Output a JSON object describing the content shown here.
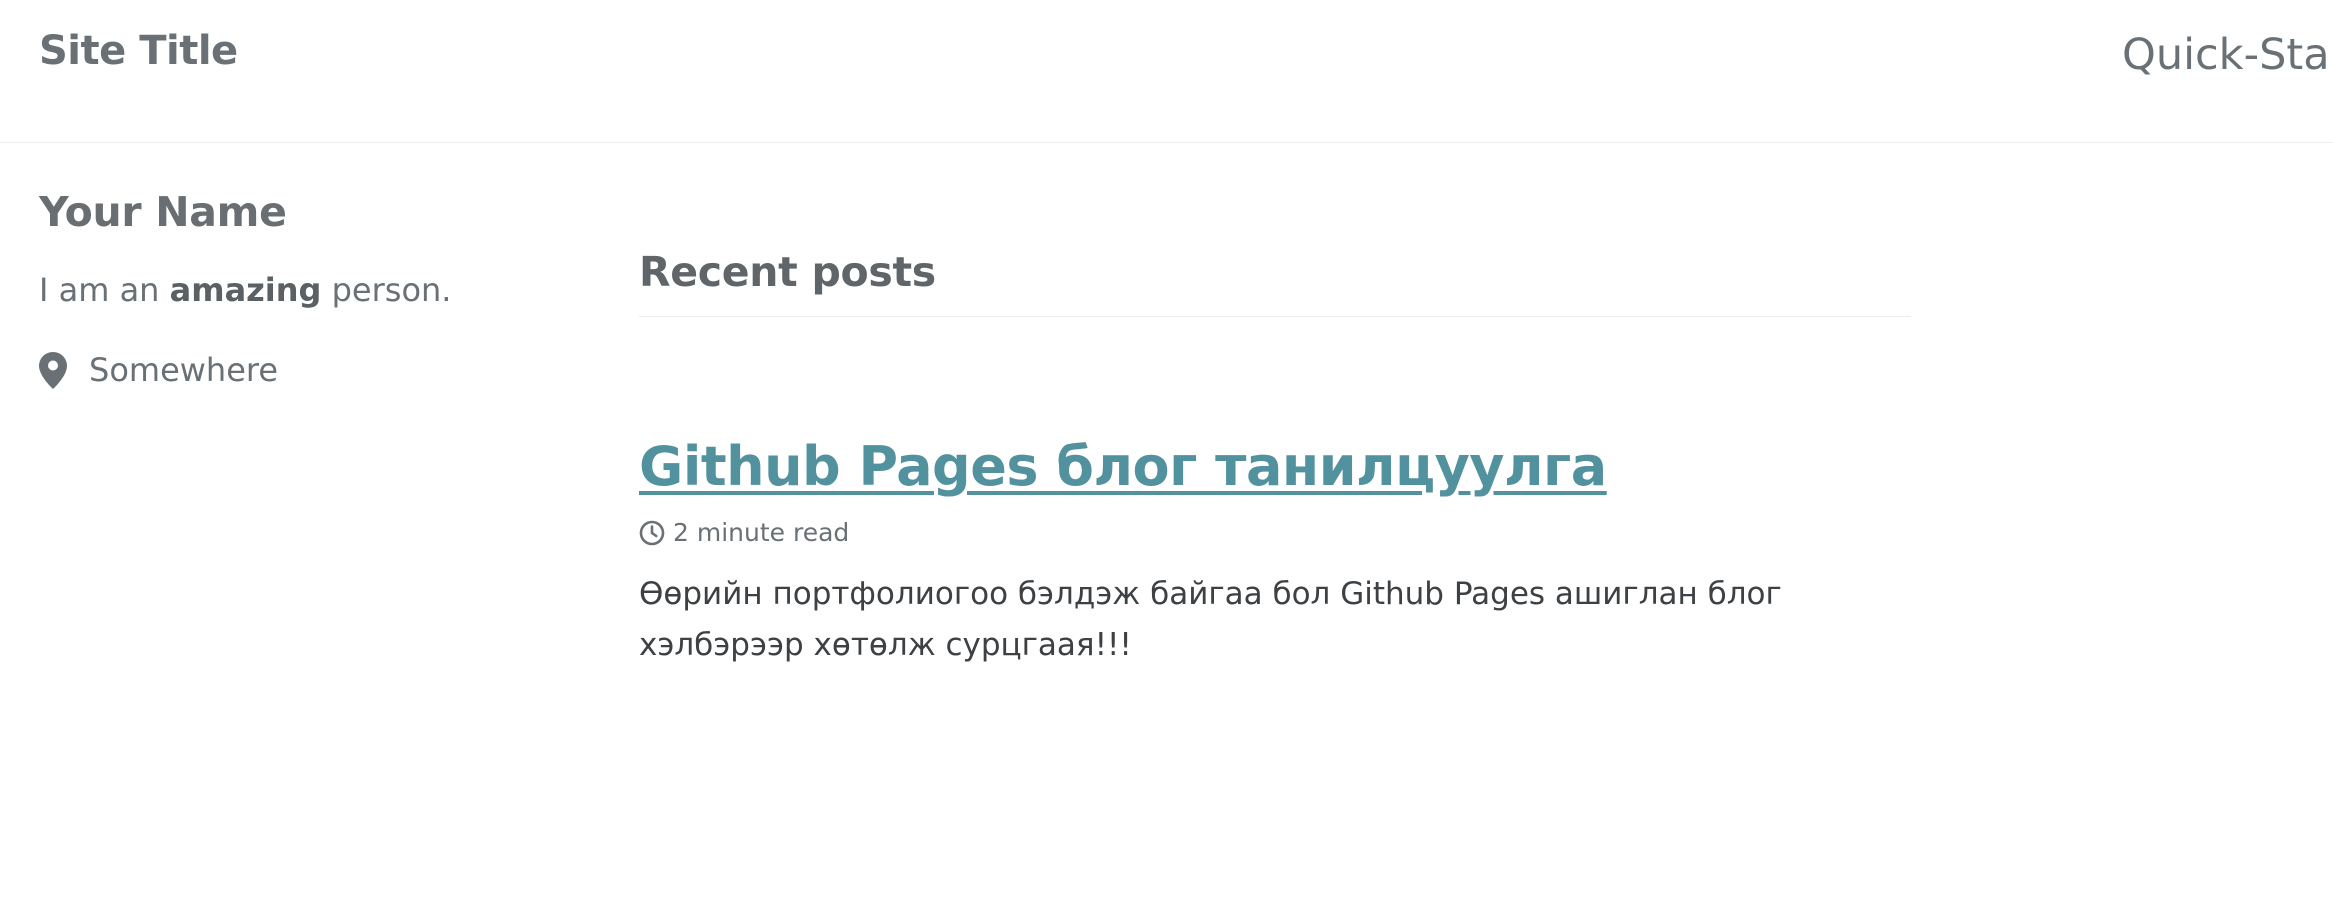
{
  "masthead": {
    "site_title": "Site Title",
    "nav": [
      {
        "label": "Quick-Start"
      }
    ]
  },
  "sidebar": {
    "author_name": "Your Name",
    "bio": {
      "prefix": "I am an ",
      "emphasis": "amazing",
      "suffix": " person."
    },
    "location": {
      "icon": "map-marker-icon",
      "text": "Somewhere"
    }
  },
  "main": {
    "section_title": "Recent posts",
    "posts": [
      {
        "title": "Github Pages блог танилцуулга",
        "read_time": "2 minute read",
        "read_time_icon": "clock-icon",
        "excerpt": "Өөрийн портфолиогоо бэлдэж байгаа бол Github Pages ашиглан блог хэлбэрээр хөтөлж сурцгаая!!!"
      }
    ]
  },
  "colors": {
    "link": "#52929e",
    "text": "#494e52",
    "muted": "#6a7176",
    "border": "#eeeeee"
  }
}
